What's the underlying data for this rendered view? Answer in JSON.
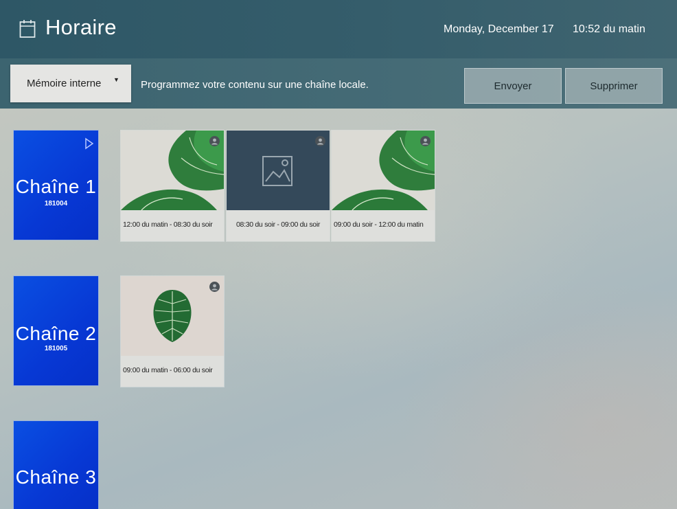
{
  "header": {
    "title": "Horaire",
    "date": "Monday, December 17",
    "time": "10:52  du matin"
  },
  "toolbar": {
    "storage_label": "Mémoire interne",
    "hint": "Programmez votre contenu sur une chaîne locale.",
    "send_label": "Envoyer",
    "delete_label": "Supprimer"
  },
  "channels": [
    {
      "name": "Chaîne  1",
      "number": "181004",
      "items": [
        {
          "range": "12:00  du matin - 08:30  du soir",
          "thumb": "monstera-leaves-image"
        },
        {
          "range": "08:30  du soir - 09:00  du soir",
          "thumb": "placeholder-image-icon"
        },
        {
          "range": "09:00  du soir - 12:00  du matin",
          "thumb": "monstera-leaves-image"
        }
      ]
    },
    {
      "name": "Chaîne  2",
      "number": "181005",
      "items": [
        {
          "range": "09:00  du matin - 06:00  du soir",
          "thumb": "monstera-leaf-image"
        }
      ]
    },
    {
      "name": "Chaîne  3",
      "number": "",
      "items": []
    }
  ],
  "colors": {
    "header_bg": "#2e5766",
    "channel_tile": "#0a4fe2",
    "button_bg": "#96a8ac",
    "card_bg": "#dedfdc"
  }
}
